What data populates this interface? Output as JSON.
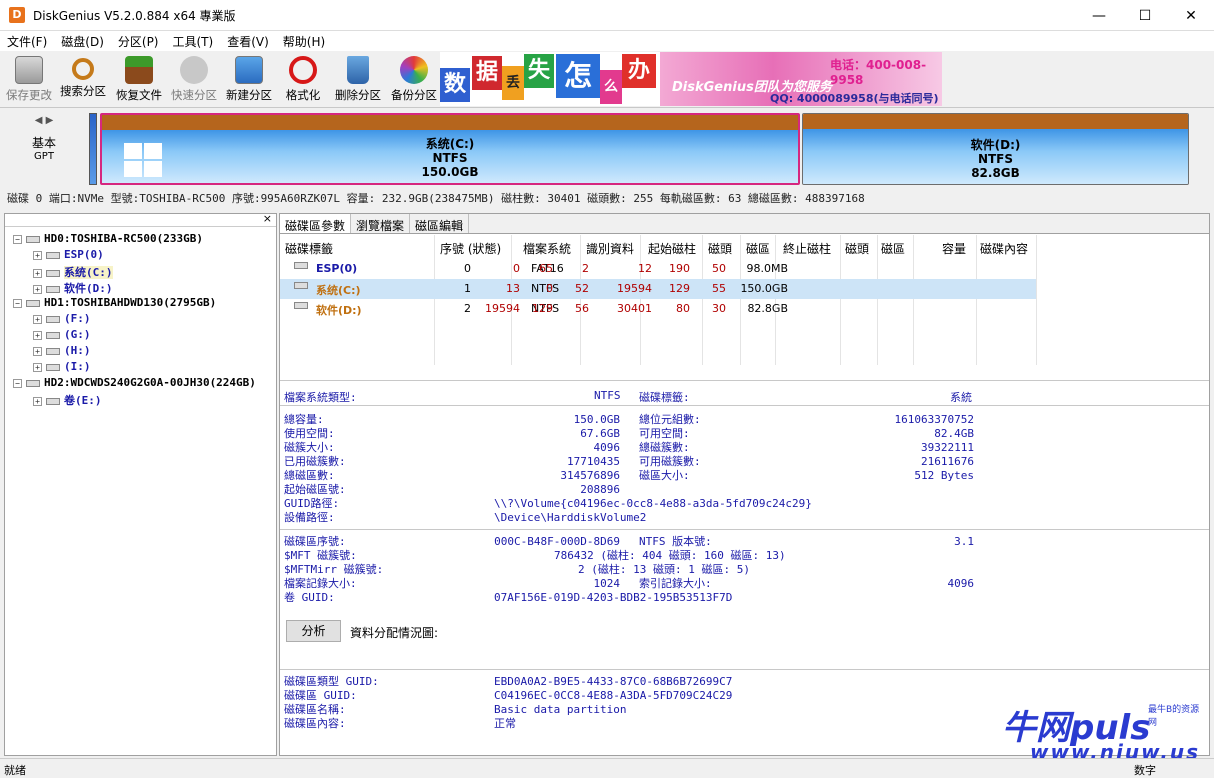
{
  "window": {
    "title": "DiskGenius V5.2.0.884 x64 專業版",
    "app_icon_letter": "D",
    "buttons": {
      "minimize": "—",
      "maximize": "☐",
      "close": "✕"
    }
  },
  "menu": [
    "文件(F)",
    "磁盘(D)",
    "分区(P)",
    "工具(T)",
    "查看(V)",
    "帮助(H)"
  ],
  "toolbar": [
    {
      "label": "保存更改",
      "icon": "save-icon",
      "enabled": false
    },
    {
      "label": "搜索分区",
      "icon": "search-icon",
      "enabled": true
    },
    {
      "label": "恢复文件",
      "icon": "recover-icon",
      "enabled": true
    },
    {
      "label": "快速分区",
      "icon": "quick-partition-icon",
      "enabled": false
    },
    {
      "label": "新建分区",
      "icon": "new-partition-icon",
      "enabled": true
    },
    {
      "label": "格式化",
      "icon": "format-icon",
      "enabled": true
    },
    {
      "label": "删除分区",
      "icon": "delete-icon",
      "enabled": true
    },
    {
      "label": "备份分区",
      "icon": "backup-icon",
      "enabled": true
    }
  ],
  "banner": {
    "chars": [
      "数",
      "据",
      "丢",
      "失",
      "怎",
      "么",
      "办"
    ],
    "char_colors": [
      "#2f5fd0",
      "#d0282e",
      "#f0a020",
      "#27a345",
      "#2a6fd8",
      "#e23a8e",
      "#e0302a"
    ],
    "team": "DiskGenius团队为您服务",
    "phone": "电话：400-008-9958",
    "qq": "QQ: 4000089958(与电话同号)"
  },
  "diskmap": {
    "type": "基本",
    "scheme": "GPT",
    "arrows": "◀ ▶",
    "partitions": [
      {
        "name": "系统(C:)",
        "fs": "NTFS",
        "size": "150.0GB"
      },
      {
        "name": "软件(D:)",
        "fs": "NTFS",
        "size": "82.8GB"
      }
    ]
  },
  "disk_info": "磁碟 0 端口:NVMe  型號:TOSHIBA-RC500  序號:995A60RZK07L  容量: 232.9GB(238475MB)  磁柱數: 30401  磁頭數: 255  每軌磁區數: 63  總磁區數: 488397168",
  "tree": {
    "close": "×",
    "items": [
      {
        "text": "HD0:TOSHIBA-RC500(233GB)",
        "kind": "disk",
        "sign": "−"
      },
      {
        "text": "ESP(0)",
        "kind": "part",
        "sign": "+"
      },
      {
        "text": "系统(C:)",
        "kind": "part",
        "sign": "+",
        "selected": true
      },
      {
        "text": "软件(D:)",
        "kind": "part",
        "sign": "+"
      },
      {
        "text": "HD1:TOSHIBAHDWD130(2795GB)",
        "kind": "disk",
        "sign": "−"
      },
      {
        "text": "(F:)",
        "kind": "part",
        "sign": "+"
      },
      {
        "text": "(G:)",
        "kind": "part",
        "sign": "+"
      },
      {
        "text": "(H:)",
        "kind": "part",
        "sign": "+"
      },
      {
        "text": "(I:)",
        "kind": "part",
        "sign": "+"
      },
      {
        "text": "HD2:WDCWDS240G2G0A-00JH30(224GB)",
        "kind": "disk",
        "sign": "−"
      },
      {
        "text": "卷(E:)",
        "kind": "part",
        "sign": "+"
      }
    ]
  },
  "tabs": [
    "磁碟區參數",
    "瀏覽檔案",
    "磁區編輯"
  ],
  "partition_table": {
    "headers": [
      "磁碟標籤",
      "序號 (狀態)",
      "檔案系統",
      "識別資料",
      "起始磁柱",
      "磁頭",
      "磁區",
      "終止磁柱",
      "磁頭",
      "磁區",
      "容量",
      "磁碟內容"
    ],
    "rows": [
      {
        "label": "ESP(0)",
        "seq": "0",
        "fs": "FAT16",
        "id": "",
        "sc": "0",
        "sh": "65",
        "ss": "2",
        "ec": "12",
        "eh": "190",
        "es": "50",
        "cap": "98.0MB"
      },
      {
        "label": "系统(C:)",
        "seq": "1",
        "fs": "NTFS",
        "id": "",
        "sc": "13",
        "sh": "0",
        "ss": "52",
        "ec": "19594",
        "eh": "129",
        "es": "55",
        "cap": "150.0GB"
      },
      {
        "label": "软件(D:)",
        "seq": "2",
        "fs": "NTFS",
        "id": "",
        "sc": "19594",
        "sh": "129",
        "ss": "56",
        "ec": "30401",
        "eh": "80",
        "es": "30",
        "cap": "82.8GB"
      }
    ]
  },
  "details": {
    "fs_type_label": "檔案系統類型:",
    "fs_type": "NTFS",
    "vol_label_label": "磁碟標籤:",
    "vol_label": "系統",
    "left": [
      [
        "總容量:",
        "150.0GB"
      ],
      [
        "使用空間:",
        "67.6GB"
      ],
      [
        "磁簇大小:",
        "4096"
      ],
      [
        "已用磁簇數:",
        "17710435"
      ],
      [
        "總磁區數:",
        "314576896"
      ],
      [
        "起始磁區號:",
        "208896"
      ]
    ],
    "right": [
      [
        "總位元組數:",
        "161063370752"
      ],
      [
        "可用空間:",
        "82.4GB"
      ],
      [
        "總磁簇數:",
        "39322111"
      ],
      [
        "可用磁簇數:",
        "21611676"
      ],
      [
        "磁區大小:",
        "512 Bytes"
      ]
    ],
    "guid_path_label": "GUID路徑:",
    "guid_path": "\\\\?\\Volume{c04196ec-0cc8-4e88-a3da-5fd709c24c29}",
    "device_path_label": "設備路徑:",
    "device_path": "\\Device\\HarddiskVolume2",
    "serial_label": "磁碟區序號:",
    "serial": "000C-B48F-000D-8D69",
    "ntfs_ver_label": "NTFS 版本號:",
    "ntfs_ver": "3.1",
    "mft_label": "$MFT 磁簇號:",
    "mft": "786432 (磁柱: 404 磁頭: 160 磁區: 13)",
    "mftmirr_label": "$MFTMirr 磁簇號:",
    "mftmirr": "2 (磁柱: 13 磁頭: 1 磁區: 5)",
    "record_size_label": "檔案記錄大小:",
    "record_size": "1024",
    "index_size_label": "索引記錄大小:",
    "index_size": "4096",
    "vol_guid_label": "卷 GUID:",
    "vol_guid": "07AF156E-019D-4203-BDB2-195B53513F7D",
    "analyze_button": "分析",
    "alloc_label": "資料分配情況圖:",
    "type_guid_label": "磁碟區類型 GUID:",
    "type_guid": "EBD0A0A2-B9E5-4433-87C0-68B6B72699C7",
    "part_guid_label": "磁碟區 GUID:",
    "part_guid": "C04196EC-0CC8-4E88-A3DA-5FD709C24C29",
    "part_name_label": "磁碟區名稱:",
    "part_name": "Basic data partition",
    "part_attr_label": "磁碟區內容:",
    "part_attr": "正常"
  },
  "status": {
    "left": "就绪",
    "right": "数字"
  },
  "watermark": {
    "big": "牛网puls",
    "small": "最牛B的资源网",
    "url": "www.niuw.us"
  }
}
